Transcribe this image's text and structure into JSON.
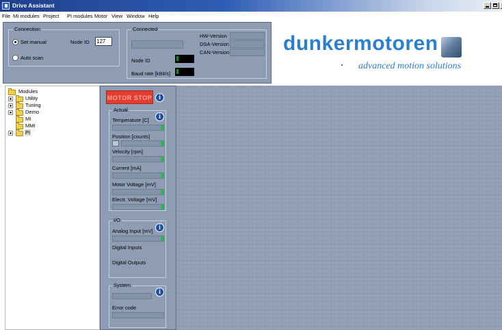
{
  "window": {
    "title": "Drive Assistant"
  },
  "menu": [
    "File",
    "MI modules",
    "Project",
    "PI modules",
    "Motor",
    "View",
    "Window",
    "Help"
  ],
  "connection": {
    "group_title": "Connection",
    "set_manual": "Set manual",
    "auto_scan": "Auto scan",
    "node_id_label": "Node ID",
    "node_id_value": "127",
    "selected_mode": "Set manual"
  },
  "connected": {
    "group_title": "Connected",
    "node_id_label": "Node ID",
    "baud_label": "Baud rate [kBit/s]",
    "hw_version": "HW-Version",
    "dsa_version": "DSA-Version",
    "can_version": "CAN-Version"
  },
  "logo": {
    "brand": "dunkermotoren",
    "tagline": "advanced motion solutions"
  },
  "tree": [
    {
      "label": "Modules",
      "level": 0,
      "expandable": false
    },
    {
      "label": "Utility",
      "level": 1,
      "expandable": true
    },
    {
      "label": "Tuning",
      "level": 1,
      "expandable": true
    },
    {
      "label": "Demo",
      "level": 1,
      "expandable": true
    },
    {
      "label": "MI",
      "level": 1,
      "expandable": false
    },
    {
      "label": "MMI",
      "level": 1,
      "expandable": false
    },
    {
      "label": "PI",
      "level": 1,
      "expandable": true,
      "selected": true
    }
  ],
  "motor": {
    "stop_label": "MOTOR STOP"
  },
  "actual": {
    "title": "Actual",
    "labels": [
      "Temperature [C]",
      "Position [counts]",
      "Velocity [rpm]",
      "Current [mA]",
      "Motor Voltage [mV]",
      "Electr. Voltage [mV]"
    ]
  },
  "io": {
    "title": "I/O",
    "analog_input": "Analog Input [mV]",
    "digital_inputs": "Digital Inputs",
    "digital_outputs": "Digital Outputs"
  },
  "system": {
    "title": "System",
    "error_code": "Error code"
  },
  "icons": {
    "info": "info-icon",
    "folder": "folder-icon",
    "open_folder": "open-folder-icon"
  },
  "colors": {
    "panel": "#8e9db3",
    "motor_stop": "#e43c2e",
    "brand_blue": "#2a7fd0",
    "title_bar": "#1f3f8c"
  }
}
